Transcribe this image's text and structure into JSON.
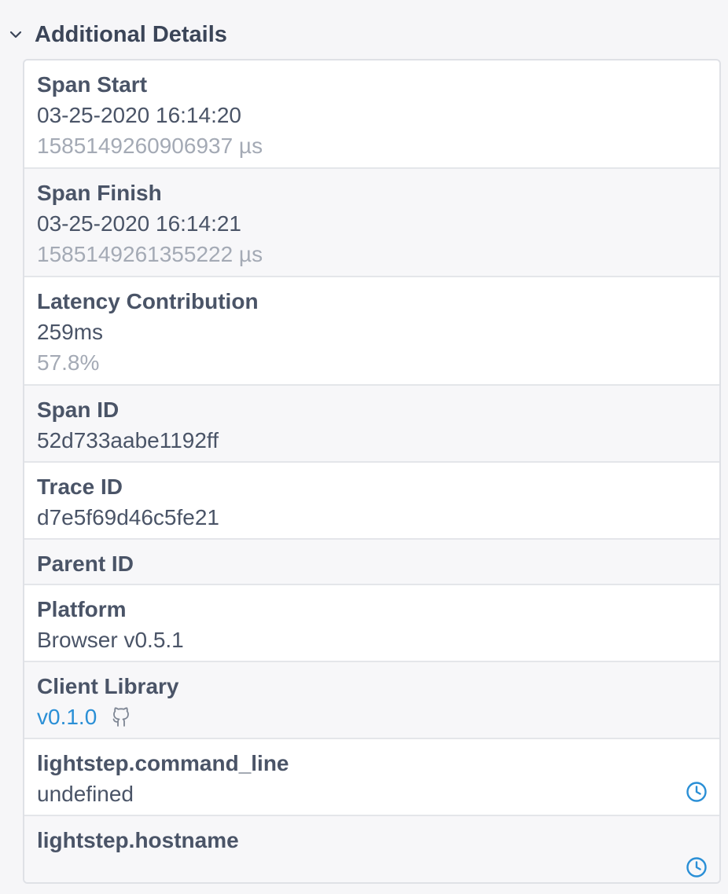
{
  "section": {
    "title": "Additional Details"
  },
  "details": {
    "span_start": {
      "label": "Span Start",
      "value": "03-25-2020 16:14:20",
      "sub": "1585149260906937 µs"
    },
    "span_finish": {
      "label": "Span Finish",
      "value": "03-25-2020 16:14:21",
      "sub": "1585149261355222 µs"
    },
    "latency": {
      "label": "Latency Contribution",
      "value": "259ms",
      "sub": "57.8%"
    },
    "span_id": {
      "label": "Span ID",
      "value": "52d733aabe1192ff"
    },
    "trace_id": {
      "label": "Trace ID",
      "value": "d7e5f69d46c5fe21"
    },
    "parent_id": {
      "label": "Parent ID"
    },
    "platform": {
      "label": "Platform",
      "value": "Browser v0.5.1"
    },
    "client_library": {
      "label": "Client Library",
      "value": "v0.1.0",
      "icon": "github-icon"
    },
    "command_line": {
      "label": "lightstep.command_line",
      "value": "undefined",
      "icon": "clock-icon"
    },
    "hostname": {
      "label": "lightstep.hostname",
      "value": "",
      "icon": "clock-icon"
    }
  },
  "colors": {
    "accent": "#2a8fd6",
    "muted": "#a4aab5",
    "text": "#4a5467",
    "border": "#dfe1e6"
  }
}
